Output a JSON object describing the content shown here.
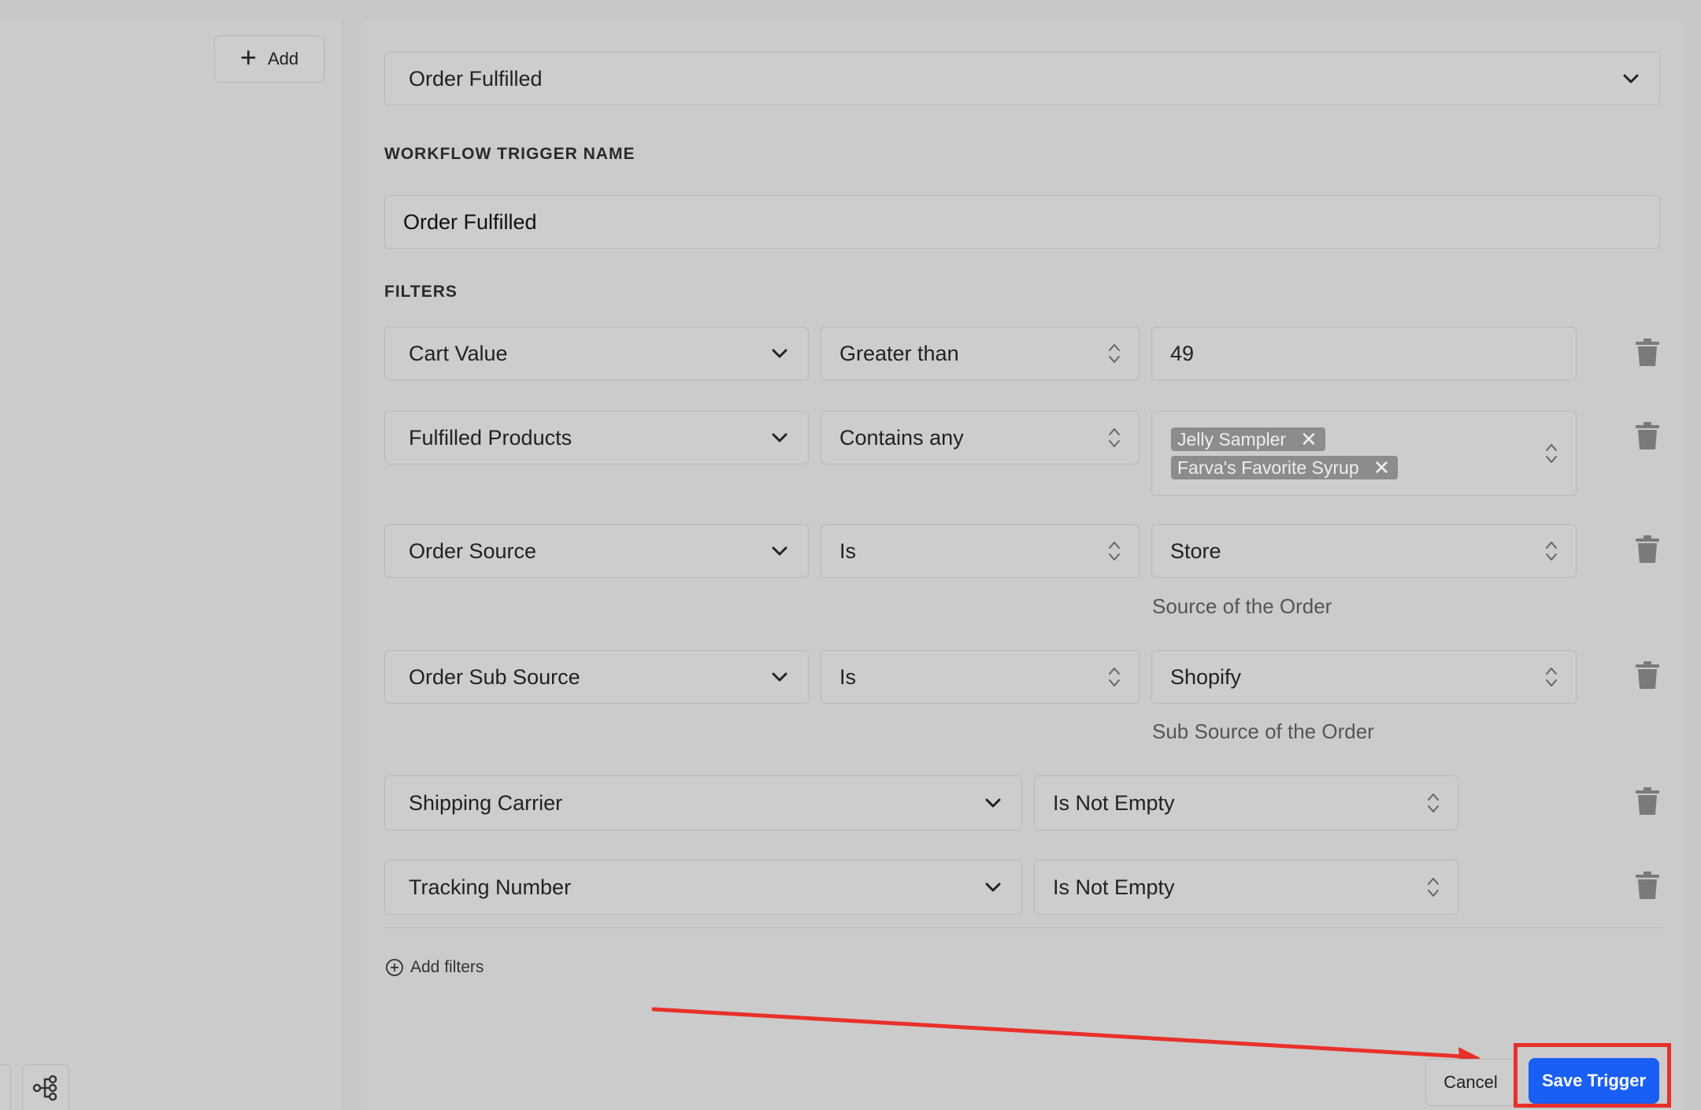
{
  "left_panel": {
    "add_label": "Add"
  },
  "trigger": {
    "event_selected": "Order Fulfilled",
    "name_label": "WORKFLOW TRIGGER NAME",
    "name_value": "Order Fulfilled"
  },
  "filters": {
    "label": "FILTERS",
    "rows": [
      {
        "field": "Cart Value",
        "operator": "Greater than",
        "value": "49"
      },
      {
        "field": "Fulfilled Products",
        "operator": "Contains any",
        "tags": [
          "Jelly Sampler",
          "Farva's Favorite Syrup"
        ]
      },
      {
        "field": "Order Source",
        "operator": "Is",
        "value": "Store",
        "helper": "Source of the Order"
      },
      {
        "field": "Order Sub Source",
        "operator": "Is",
        "value": "Shopify",
        "helper": "Sub Source of the Order"
      },
      {
        "field": "Shipping Carrier",
        "operator": "Is Not Empty"
      },
      {
        "field": "Tracking Number",
        "operator": "Is Not Empty"
      }
    ],
    "add_filters_label": "Add filters"
  },
  "actions": {
    "cancel_label": "Cancel",
    "save_label": "Save Trigger"
  },
  "colors": {
    "primary": "#1a5ff5",
    "annotation": "#e8302a",
    "background": "#c8c8c8"
  }
}
